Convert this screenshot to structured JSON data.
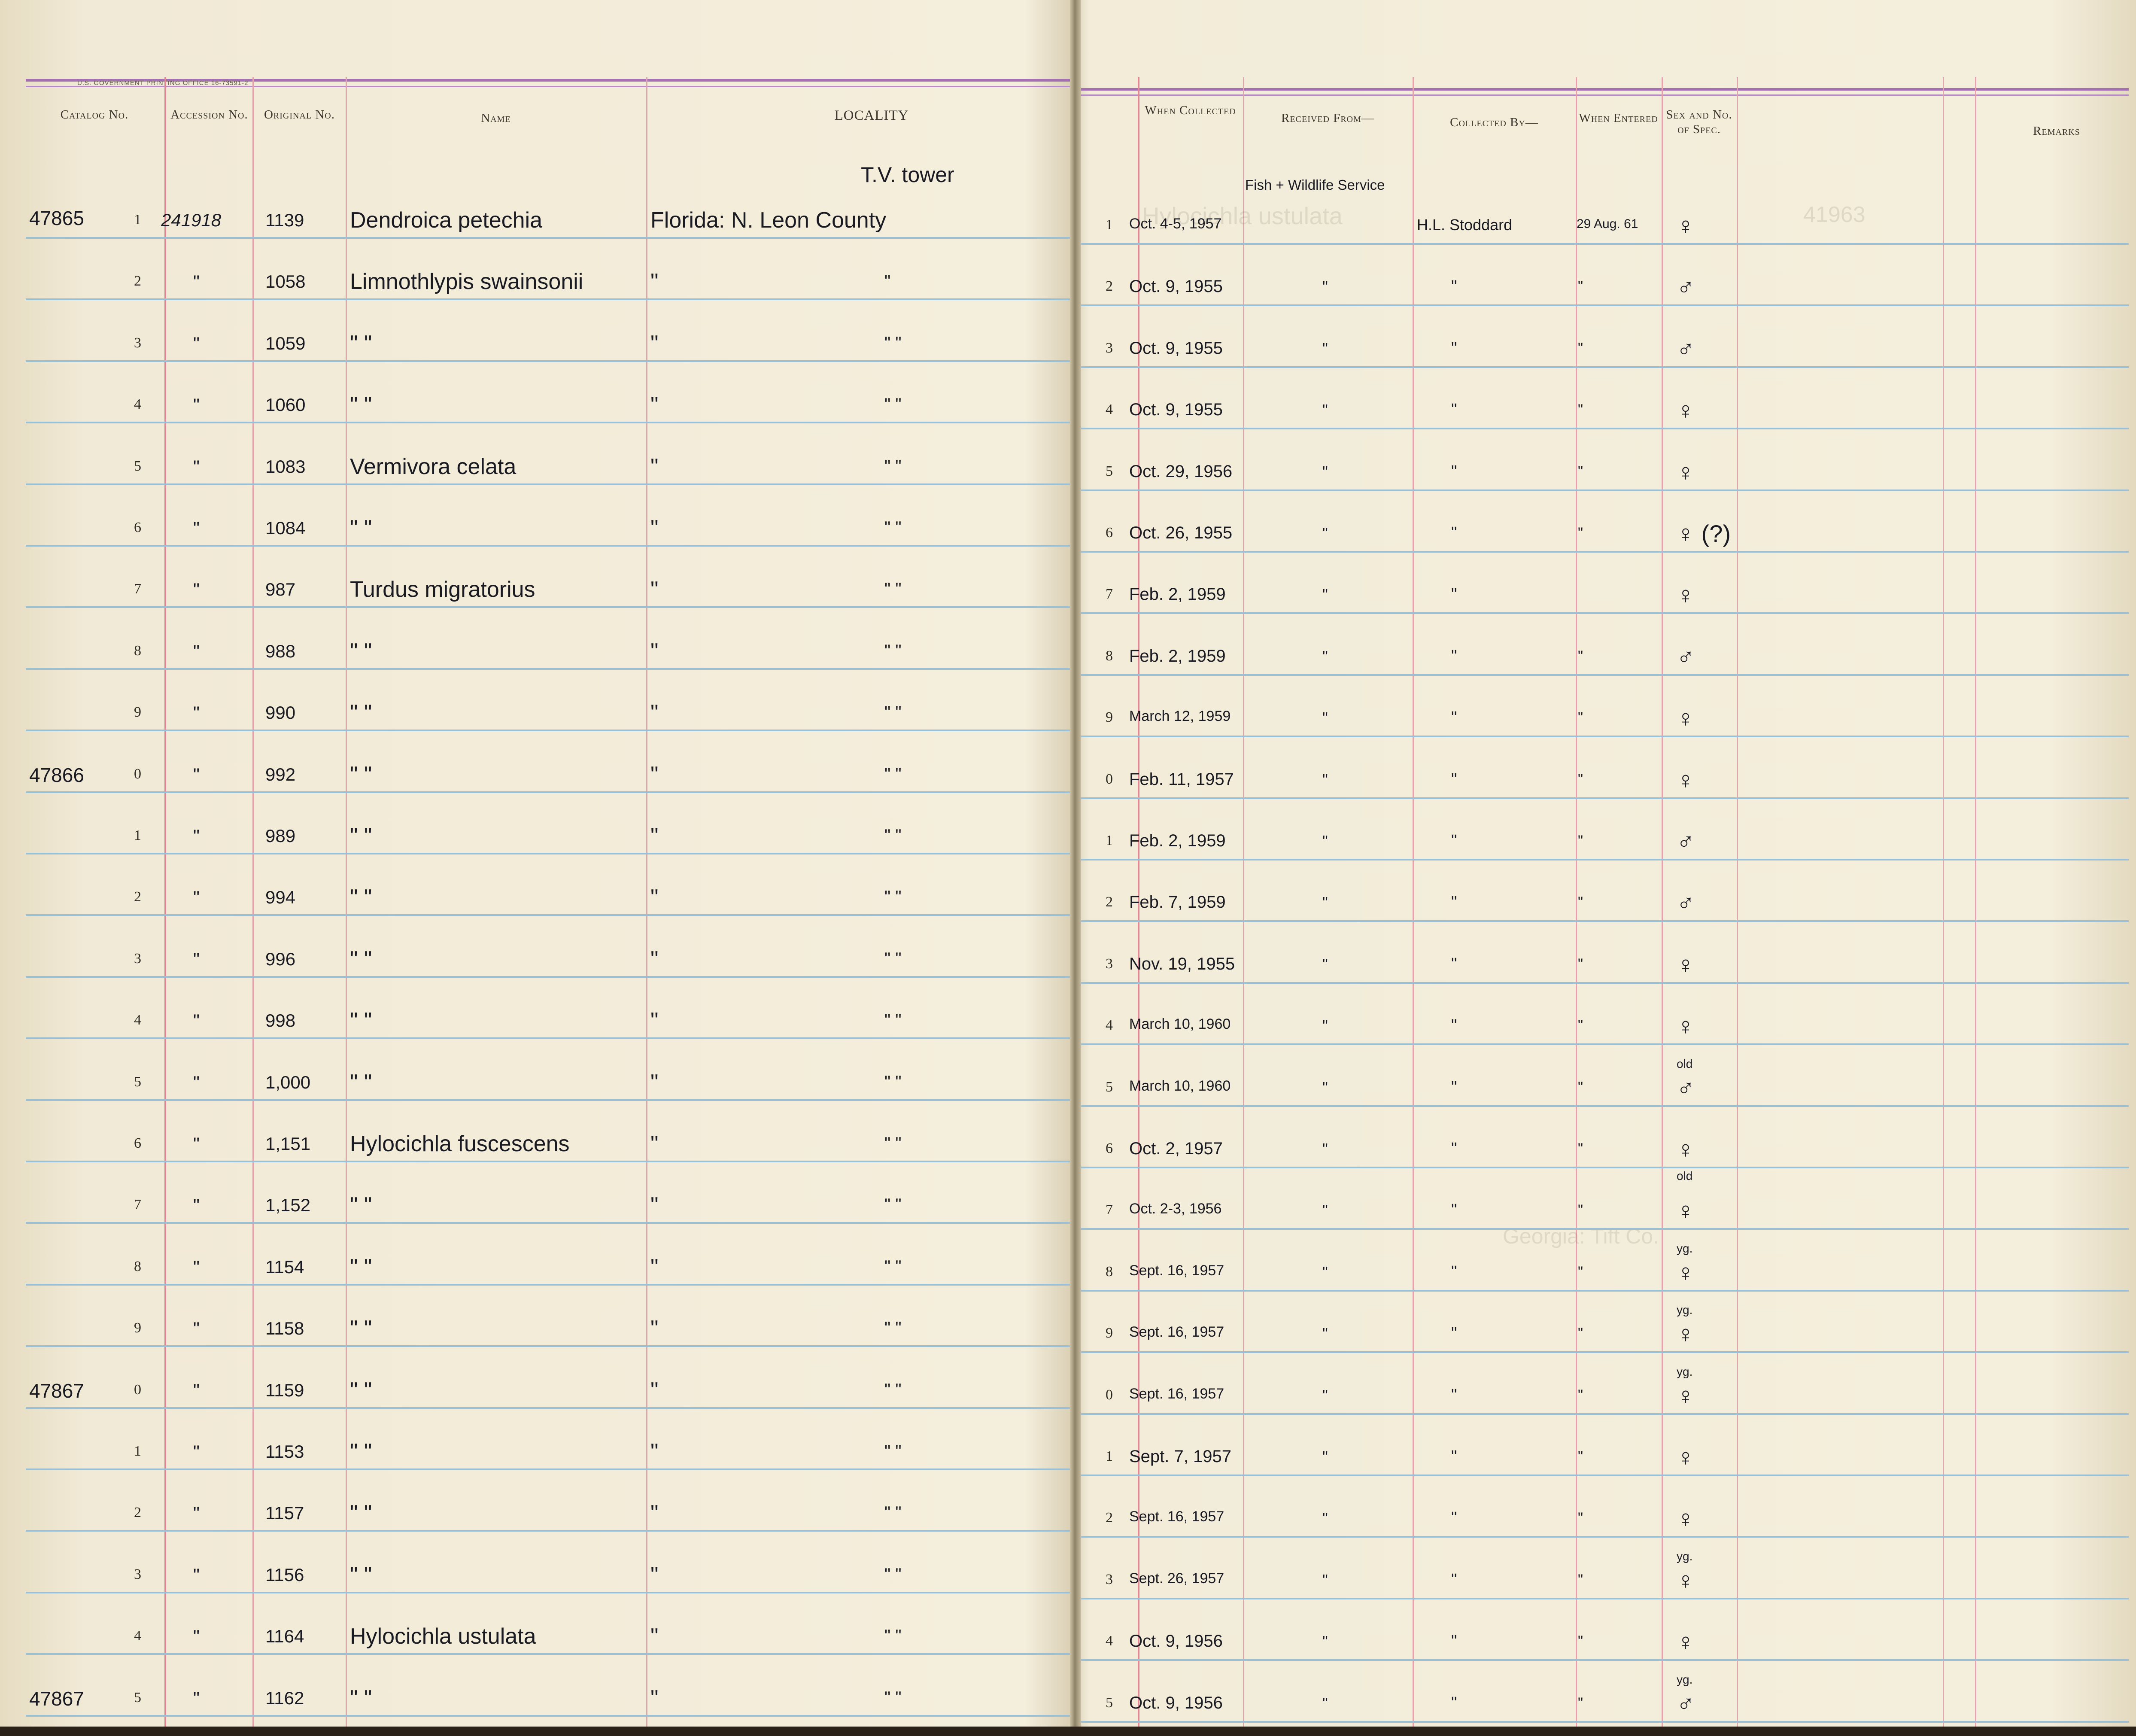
{
  "form": {
    "imprint": "U.S. GOVERNMENT PRINTING OFFICE    16-73591-2"
  },
  "headers": {
    "catalog_no": "Catalog No.",
    "accession_no": "Accession No.",
    "original_no": "Original No.",
    "name": "Name",
    "locality": "LOCALITY",
    "when_collected": "When Collected",
    "received_from": "Received From—",
    "collected_by": "Collected By—",
    "when_entered": "When Entered",
    "sex_spec": "Sex and No. of Spec.",
    "remarks": "Remarks"
  },
  "annotations": {
    "locality_above": "T.V. tower",
    "received_above": "Fish + Wildlife Service"
  },
  "rows": [
    {
      "cat": "47865",
      "d": "1",
      "acc": "241918",
      "orig": "1139",
      "name": "Dendroica petechia",
      "loc": "Florida: N. Leon County",
      "loc2": "",
      "rd": "1",
      "date": "Oct. 4-5, 1957",
      "recv": "",
      "coll": "H.L. Stoddard",
      "ent": "29 Aug. 61",
      "sex": "♀",
      "sexnote": ""
    },
    {
      "cat": "",
      "d": "2",
      "acc": "\"",
      "orig": "1058",
      "name": "Limnothlypis swainsonii",
      "loc": "\"",
      "loc2": "\"",
      "rd": "2",
      "date": "Oct. 9, 1955",
      "recv": "\"",
      "coll": "\"",
      "ent": "\"",
      "sex": "♂",
      "sexnote": ""
    },
    {
      "cat": "",
      "d": "3",
      "acc": "\"",
      "orig": "1059",
      "name": "\"     \"",
      "loc": "\"",
      "loc2": "\"     \"",
      "rd": "3",
      "date": "Oct. 9, 1955",
      "recv": "\"",
      "coll": "\"",
      "ent": "\"",
      "sex": "♂",
      "sexnote": ""
    },
    {
      "cat": "",
      "d": "4",
      "acc": "\"",
      "orig": "1060",
      "name": "\"     \"",
      "loc": "\"",
      "loc2": "\"     \"",
      "rd": "4",
      "date": "Oct. 9, 1955",
      "recv": "\"",
      "coll": "\"",
      "ent": "\"",
      "sex": "♀",
      "sexnote": ""
    },
    {
      "cat": "",
      "d": "5",
      "acc": "\"",
      "orig": "1083",
      "name": "Vermivora celata",
      "loc": "\"",
      "loc2": "\"     \"",
      "rd": "5",
      "date": "Oct. 29, 1956",
      "recv": "\"",
      "coll": "\"",
      "ent": "\"",
      "sex": "♀",
      "sexnote": ""
    },
    {
      "cat": "",
      "d": "6",
      "acc": "\"",
      "orig": "1084",
      "name": "\"     \"",
      "loc": "\"",
      "loc2": "\"     \"",
      "rd": "6",
      "date": "Oct. 26, 1955",
      "recv": "\"",
      "coll": "\"",
      "ent": "\"",
      "sex": "♀ (?)",
      "sexnote": ""
    },
    {
      "cat": "",
      "d": "7",
      "acc": "\"",
      "orig": "987",
      "name": "Turdus migratorius",
      "loc": "\"",
      "loc2": "\"     \"",
      "rd": "7",
      "date": "Feb. 2, 1959",
      "recv": "\"",
      "coll": "\"",
      "ent": "",
      "sex": "♀",
      "sexnote": ""
    },
    {
      "cat": "",
      "d": "8",
      "acc": "\"",
      "orig": "988",
      "name": "\"     \"",
      "loc": "\"",
      "loc2": "\"     \"",
      "rd": "8",
      "date": "Feb. 2, 1959",
      "recv": "\"",
      "coll": "\"",
      "ent": "\"",
      "sex": "♂",
      "sexnote": ""
    },
    {
      "cat": "",
      "d": "9",
      "acc": "\"",
      "orig": "990",
      "name": "\"     \"",
      "loc": "\"",
      "loc2": "\"     \"",
      "rd": "9",
      "date": "March 12, 1959",
      "recv": "\"",
      "coll": "\"",
      "ent": "\"",
      "sex": "♀",
      "sexnote": ""
    },
    {
      "cat": "47866",
      "d": "0",
      "acc": "\"",
      "orig": "992",
      "name": "\"     \"",
      "loc": "\"",
      "loc2": "\"     \"",
      "rd": "0",
      "date": "Feb. 11, 1957",
      "recv": "\"",
      "coll": "\"",
      "ent": "\"",
      "sex": "♀",
      "sexnote": ""
    },
    {
      "cat": "",
      "d": "1",
      "acc": "\"",
      "orig": "989",
      "name": "\"     \"",
      "loc": "\"",
      "loc2": "\"     \"",
      "rd": "1",
      "date": "Feb. 2, 1959",
      "recv": "\"",
      "coll": "\"",
      "ent": "\"",
      "sex": "♂",
      "sexnote": ""
    },
    {
      "cat": "",
      "d": "2",
      "acc": "\"",
      "orig": "994",
      "name": "\"     \"",
      "loc": "\"",
      "loc2": "\"     \"",
      "rd": "2",
      "date": "Feb. 7, 1959",
      "recv": "\"",
      "coll": "\"",
      "ent": "\"",
      "sex": "♂",
      "sexnote": ""
    },
    {
      "cat": "",
      "d": "3",
      "acc": "\"",
      "orig": "996",
      "name": "\"     \"",
      "loc": "\"",
      "loc2": "\"     \"",
      "rd": "3",
      "date": "Nov. 19, 1955",
      "recv": "\"",
      "coll": "\"",
      "ent": "\"",
      "sex": "♀",
      "sexnote": ""
    },
    {
      "cat": "",
      "d": "4",
      "acc": "\"",
      "orig": "998",
      "name": "\"     \"",
      "loc": "\"",
      "loc2": "\"     \"",
      "rd": "4",
      "date": "March 10, 1960",
      "recv": "\"",
      "coll": "\"",
      "ent": "\"",
      "sex": "♀",
      "sexnote": ""
    },
    {
      "cat": "",
      "d": "5",
      "acc": "\"",
      "orig": "1,000",
      "name": "\"     \"",
      "loc": "\"",
      "loc2": "\"     \"",
      "rd": "5",
      "date": "March 10, 1960",
      "recv": "\"",
      "coll": "\"",
      "ent": "\"",
      "sex": "♂",
      "sexnote": "old"
    },
    {
      "cat": "",
      "d": "6",
      "acc": "\"",
      "orig": "1,151",
      "name": "Hylocichla fuscescens",
      "loc": "\"",
      "loc2": "\"     \"",
      "rd": "6",
      "date": "Oct. 2, 1957",
      "recv": "\"",
      "coll": "\"",
      "ent": "\"",
      "sex": "♀",
      "sexnote": "old"
    },
    {
      "cat": "",
      "d": "7",
      "acc": "\"",
      "orig": "1,152",
      "name": "\"     \"",
      "loc": "\"",
      "loc2": "\"     \"",
      "rd": "7",
      "date": "Oct. 2-3, 1956",
      "recv": "\"",
      "coll": "\"",
      "ent": "\"",
      "sex": "♀",
      "sexnote": ""
    },
    {
      "cat": "",
      "d": "8",
      "acc": "\"",
      "orig": "1154",
      "name": "\"     \"",
      "loc": "\"",
      "loc2": "\"     \"",
      "rd": "8",
      "date": "Sept. 16, 1957",
      "recv": "\"",
      "coll": "\"",
      "ent": "\"",
      "sex": "♀",
      "sexnote": "yg."
    },
    {
      "cat": "",
      "d": "9",
      "acc": "\"",
      "orig": "1158",
      "name": "\"     \"",
      "loc": "\"",
      "loc2": "\"     \"",
      "rd": "9",
      "date": "Sept. 16, 1957",
      "recv": "\"",
      "coll": "\"",
      "ent": "\"",
      "sex": "♀",
      "sexnote": "yg."
    },
    {
      "cat": "47867",
      "d": "0",
      "acc": "\"",
      "orig": "1159",
      "name": "\"     \"",
      "loc": "\"",
      "loc2": "\"     \"",
      "rd": "0",
      "date": "Sept. 16, 1957",
      "recv": "\"",
      "coll": "\"",
      "ent": "\"",
      "sex": "♀",
      "sexnote": "yg."
    },
    {
      "cat": "",
      "d": "1",
      "acc": "\"",
      "orig": "1153",
      "name": "\"     \"",
      "loc": "\"",
      "loc2": "\"     \"",
      "rd": "1",
      "date": "Sept. 7, 1957",
      "recv": "\"",
      "coll": "\"",
      "ent": "\"",
      "sex": "♀",
      "sexnote": ""
    },
    {
      "cat": "",
      "d": "2",
      "acc": "\"",
      "orig": "1157",
      "name": "\"     \"",
      "loc": "\"",
      "loc2": "\"     \"",
      "rd": "2",
      "date": "Sept. 16, 1957",
      "recv": "\"",
      "coll": "\"",
      "ent": "\"",
      "sex": "♀",
      "sexnote": ""
    },
    {
      "cat": "",
      "d": "3",
      "acc": "\"",
      "orig": "1156",
      "name": "\"     \"",
      "loc": "\"",
      "loc2": "\"     \"",
      "rd": "3",
      "date": "Sept. 26, 1957",
      "recv": "\"",
      "coll": "\"",
      "ent": "\"",
      "sex": "♀",
      "sexnote": "yg."
    },
    {
      "cat": "",
      "d": "4",
      "acc": "\"",
      "orig": "1164",
      "name": "Hylocichla ustulata",
      "loc": "\"",
      "loc2": "\"     \"",
      "rd": "4",
      "date": "Oct. 9, 1956",
      "recv": "\"",
      "coll": "\"",
      "ent": "\"",
      "sex": "♀",
      "sexnote": ""
    },
    {
      "cat": "47867",
      "d": "5",
      "acc": "\"",
      "orig": "1162",
      "name": "\"     \"",
      "loc": "\"",
      "loc2": "\"     \"",
      "rd": "5",
      "date": "Oct. 9, 1956",
      "recv": "\"",
      "coll": "\"",
      "ent": "\"",
      "sex": "♂",
      "sexnote": "yg."
    }
  ],
  "colors": {
    "rule_blue": "#9bbfd4",
    "rule_red": "#dd8a96",
    "rule_purple": "#a56fb3",
    "ink": "#1a1a22",
    "paper": "#f4eedc"
  }
}
